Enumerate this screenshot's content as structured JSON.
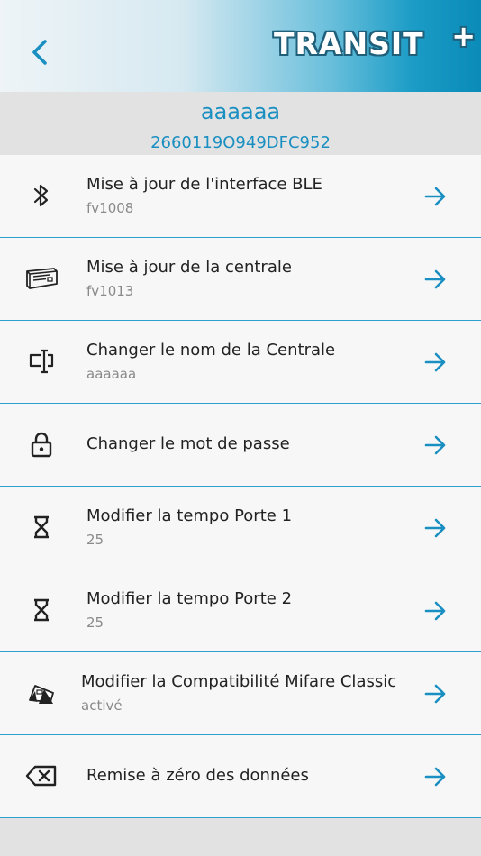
{
  "header": {
    "back_icon": "chevron-left-icon",
    "logo_text": "TRANSIT+",
    "logo_main": "TRANSIT",
    "logo_plus": "+",
    "colors": {
      "accent": "#1a8fc1",
      "gradient_end": "#0a8bb8"
    }
  },
  "device": {
    "name": "aaaaaa",
    "id": "2660119O949DFC952"
  },
  "menu": {
    "items": [
      {
        "icon": "bluetooth-icon",
        "title": "Mise à jour de l'interface BLE",
        "subtitle": "fv1008"
      },
      {
        "icon": "controller-box-icon",
        "title": "Mise à jour de la centrale",
        "subtitle": "fv1013"
      },
      {
        "icon": "rename-icon",
        "title": "Changer le nom de la Centrale",
        "subtitle": "aaaaaa"
      },
      {
        "icon": "lock-icon",
        "title": "Changer le mot de passe",
        "subtitle": ""
      },
      {
        "icon": "hourglass-icon",
        "title": "Modifier la tempo Porte 1",
        "subtitle": "25"
      },
      {
        "icon": "hourglass-icon",
        "title": "Modifier la tempo Porte 2",
        "subtitle": "25"
      },
      {
        "icon": "card-reader-icon",
        "title": "Modifier la Compatibilité Mifare Classic",
        "subtitle": "activé"
      },
      {
        "icon": "backspace-icon",
        "title": "Remise à zéro des données",
        "subtitle": ""
      }
    ],
    "arrow_icon": "arrow-right-icon"
  }
}
